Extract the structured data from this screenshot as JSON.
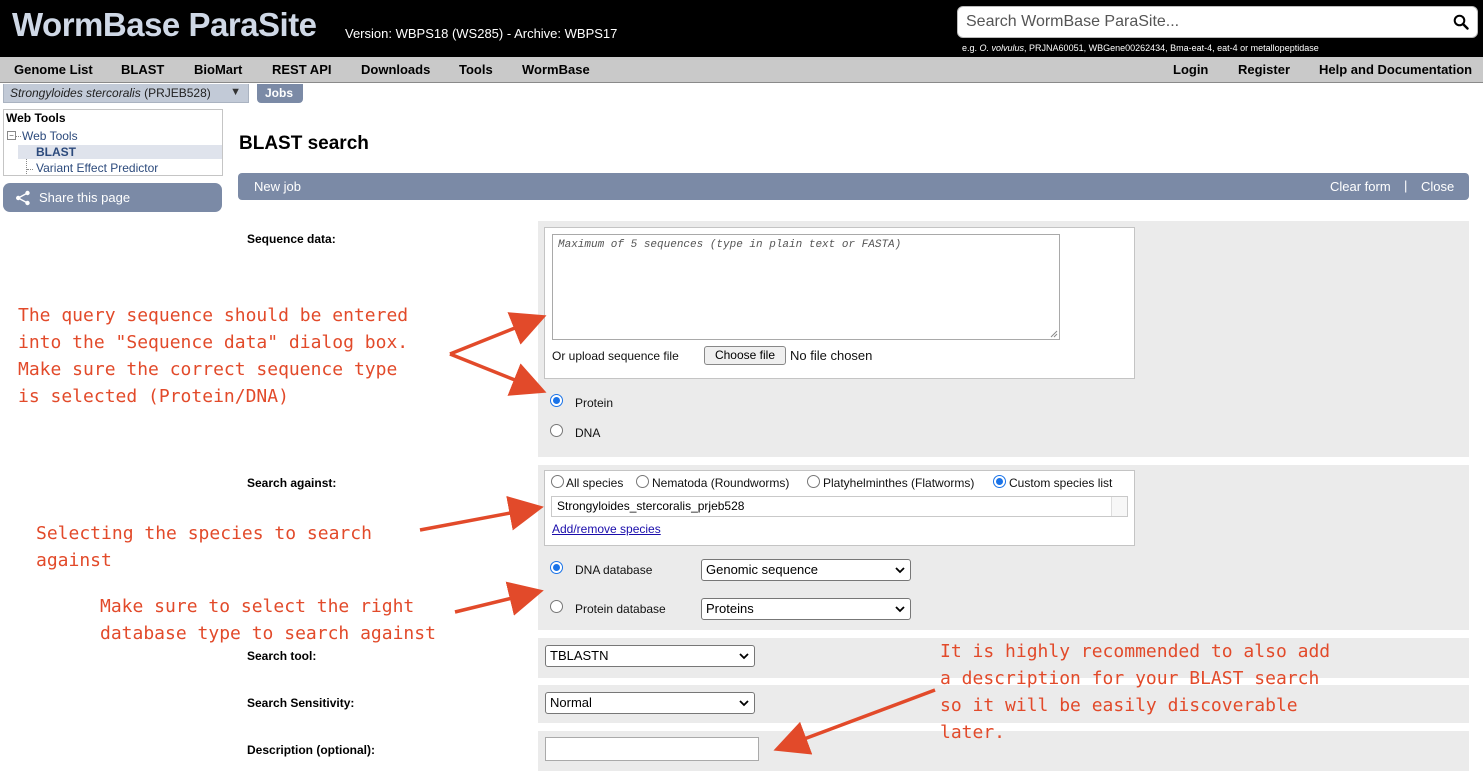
{
  "header": {
    "logo": "WormBase ParaSite",
    "version_text": "Version: WBPS18 (WS285)  -  Archive: WBPS17",
    "search_placeholder": "Search WormBase ParaSite...",
    "search_hint_prefix": "e.g. ",
    "search_hint_italic": "O. volvulus",
    "search_hint_rest": ", PRJNA60051, WBGene00262434, Bma-eat-4, eat-4 or metallopeptidase"
  },
  "nav": {
    "left": [
      "Genome List",
      "BLAST",
      "BioMart",
      "REST API",
      "Downloads",
      "Tools",
      "WormBase"
    ],
    "right": [
      "Login",
      "Register",
      "Help and Documentation"
    ]
  },
  "species_selector": {
    "italic": "Strongyloides stercoralis",
    "rest": " (PRJEB528)",
    "arrow": "▼"
  },
  "jobs_tab": "Jobs",
  "sidebar": {
    "title": "Web Tools",
    "tree_root": "Web Tools",
    "items": [
      "BLAST",
      "Variant Effect Predictor"
    ],
    "active_item": "BLAST",
    "share_label": "Share this page"
  },
  "main": {
    "title": "BLAST search",
    "jobbar": {
      "new_job": "New job",
      "clear_form": "Clear form",
      "separator": "|",
      "close": "Close"
    },
    "sequence": {
      "label": "Sequence data:",
      "placeholder": "Maximum of 5 sequences (type in plain text or FASTA)",
      "upload_label": "Or upload sequence file",
      "choose_file": "Choose file",
      "no_file": "No file chosen",
      "types": [
        {
          "label": "Protein",
          "checked": true
        },
        {
          "label": "DNA",
          "checked": false
        }
      ]
    },
    "search_against": {
      "label": "Search against:",
      "options": [
        {
          "label": "All species",
          "checked": false
        },
        {
          "label": "Nematoda (Roundworms)",
          "checked": false
        },
        {
          "label": "Platyhelminthes (Flatworms)",
          "checked": false
        },
        {
          "label": "Custom species list",
          "checked": true
        }
      ],
      "selected_species": "Strongyloides_stercoralis_prjeb528",
      "add_remove_link": "Add/remove species",
      "dna_db_label": "DNA database",
      "dna_db_value": "Genomic sequence",
      "dna_db_checked": true,
      "protein_db_label": "Protein database",
      "protein_db_value": "Proteins",
      "protein_db_checked": false
    },
    "search_tool": {
      "label": "Search tool:",
      "value": "TBLASTN"
    },
    "sensitivity": {
      "label": "Search Sensitivity:",
      "value": "Normal"
    },
    "description": {
      "label": "Description (optional):",
      "value": ""
    }
  },
  "annotations": {
    "sequence_note": "The query sequence should be entered\ninto the \"Sequence data\" dialog box.\nMake sure the correct sequence type\nis selected (Protein/DNA)",
    "species_note": "Selecting the species to search\nagainst",
    "database_note": "Make sure to select the right\ndatabase type to search against",
    "description_note": "It is highly recommended to also add\na description for your BLAST search\nso it will be easily discoverable\nlater."
  },
  "colors": {
    "header_bg": "#000000",
    "nav_bg": "#c9c9c9",
    "accent_bar": "#7b8aa6",
    "panel_bg": "#ebebeb",
    "annotation": "#e24a2a",
    "radio_checked": "#1a73e8",
    "link": "#1a0dab"
  },
  "icons": {
    "search": "magnifier-icon",
    "share": "share-icon",
    "dropdown": "chevron-down-icon"
  }
}
